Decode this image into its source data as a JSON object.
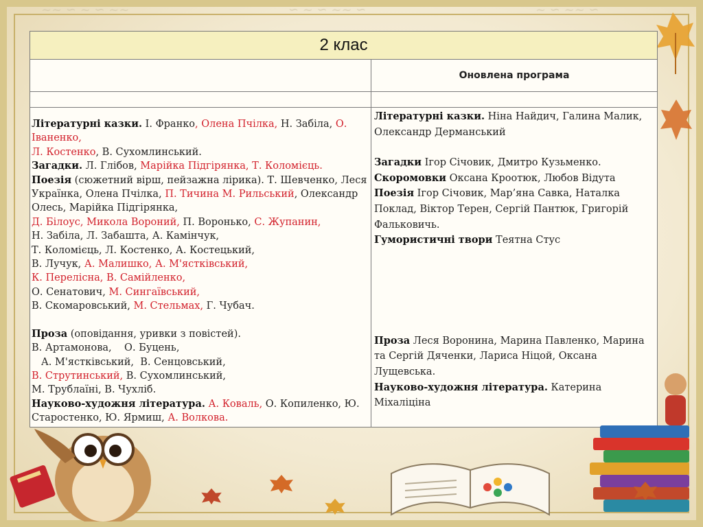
{
  "table": {
    "title": "2 клас",
    "left_header": "",
    "right_header": "Оновлена програма",
    "left": {
      "line1": {
        "b": "Літературні казки.",
        "t1": " І. Франко",
        "r1": ", Олена Пчілка,",
        "t2": "  Н. Забіла,  ",
        "r2": " О. Іваненко,"
      },
      "line2": {
        "r1": " Л. Костенко",
        "t1": ", В. Сухомлинський."
      },
      "line3": {
        "b": "Загадки.",
        "t1": "  Л. Глібов, ",
        "r1": " Марійка Підгірянка, Т. Коломієць."
      },
      "line4": {
        "b": "Поезія",
        "t1": " (сюжетний вірш, пейзажна лірика). Т. Шевченко, Леся Українка, Олена Пчілка, ",
        "r1": " П. Тичина  М. Рильський",
        "t2": ",  Олександр Олесь,   Марійка   Підгірянка,"
      },
      "line5": {
        "r1": "Д. Білоус, Микола Вороний,",
        "t1": " П. Воронько, ",
        "r2": "С. Жупанин,"
      },
      "line6": {
        "t1": "Н. Забіла, Л. Забашта, А. Камінчук,"
      },
      "line7": {
        "t1": "Т. Коломієць, Л. Костенко, А. Костецький,"
      },
      "line8": {
        "t1": "В. Лучук, ",
        "r1": "А. Малишко, А.  М'ястківський,"
      },
      "line9": {
        "r1": "К. Перелісна,   В. Самійленко,"
      },
      "line10": {
        "t1": "О. Сенатович, ",
        "r1": " М. Сингаївський,"
      },
      "line11": {
        "t1": " В. Скомаровський, ",
        "r1": "М. Стельмах,",
        "t2": " Г. Чубач."
      },
      "line12": {
        "b": "Проза",
        "t1": " (оповідання, уривки з повістей)."
      },
      "line13": {
        "t1": "В. Артамонова,    О. Буцень,"
      },
      "line14": {
        "t1": "   А. М'ястківський,  В. Сенцовський,"
      },
      "line15": {
        "r1": " В. Струтинський,",
        "t1": " В. Сухомлинський,"
      },
      "line16": {
        "t1": "М. Трублаїні, В. Чухліб."
      },
      "line17": {
        "b": "Науково-художня література.",
        "t1": " ",
        "r1": "А. Коваль,",
        "t2": " О. Копиленко, Ю. Старостенко, Ю. Ярмиш, ",
        "r2": "А. Волкова."
      }
    },
    "right": {
      "p1": {
        "b": "Літературні казки.",
        "t1": " Ніна Найдич,  Галина Малик, Олександр Дерманський"
      },
      "p2": {
        "b": "Загадки",
        "t1": "  Ігор Січовик, Дмитро Кузьменко."
      },
      "p3": {
        "b": "Скоромовки",
        "t1": "   Оксана Кроотюк, Любов Відута"
      },
      "p4": {
        "b": "Поезія",
        "t1": " Ігор Січовик, Мар’яна Савка, Наталка Поклад, Віктор Терен, Сергій Пантюк, Григорій Фальковичь."
      },
      "p5": {
        "b": "Гумористичні твори",
        "t1": " Теятна Стус"
      },
      "p6": {
        "b": "Проза",
        "t1": " Леся Воронина, Марина Павленко, Марина та Сергій Дяченки, Лариса Ніцой, Оксана Лущевська."
      },
      "p7": {
        "b": "Науково-художня література.",
        "t1": "  Катерина Міхаліціна"
      }
    }
  },
  "colors": {
    "accent_red": "#d2202b",
    "title_bg": "#f6f0bf",
    "frame": "#d8c78c"
  }
}
